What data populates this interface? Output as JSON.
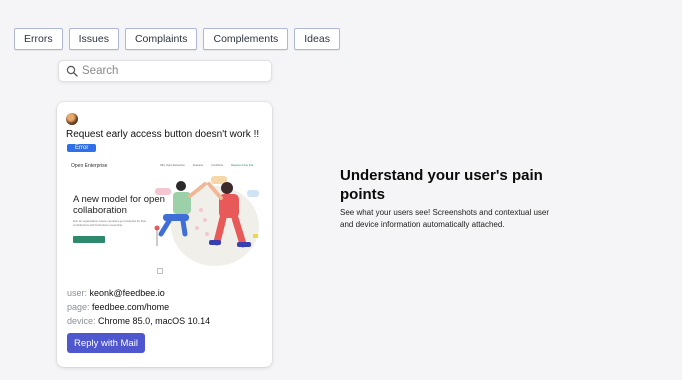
{
  "tabs": [
    {
      "label": "Errors"
    },
    {
      "label": "Issues"
    },
    {
      "label": "Complaints"
    },
    {
      "label": "Complements"
    },
    {
      "label": "Ideas"
    }
  ],
  "search": {
    "placeholder": "Search",
    "icon": "search-icon"
  },
  "card": {
    "title": "Request early access button doesn't work !!",
    "badge": "Error",
    "badge_color": "#2f6fe8",
    "screenshot": {
      "brand": "Open Enterprise",
      "menu": [
        "Why Open Enterprise",
        "Features",
        "Contribute",
        "Request a free trial"
      ],
      "headline": "A new model for open collaboration",
      "subtext": "Run an organisation where members get rewarded for their contributions with frictionless ownership."
    },
    "meta": {
      "user_key": "user:",
      "user_value": "keonk@feedbee.io",
      "page_key": "page:",
      "page_value": "feedbee.com/home",
      "device_key": "device:",
      "device_value": "Chrome 85.0, macOS 10.14"
    },
    "reply_label": "Reply with Mail",
    "reply_color": "#4f57cf"
  },
  "feature": {
    "headline": "Understand your user's pain points",
    "description": "See what your users see! Screenshots and contextual user and device information automatically attached."
  }
}
